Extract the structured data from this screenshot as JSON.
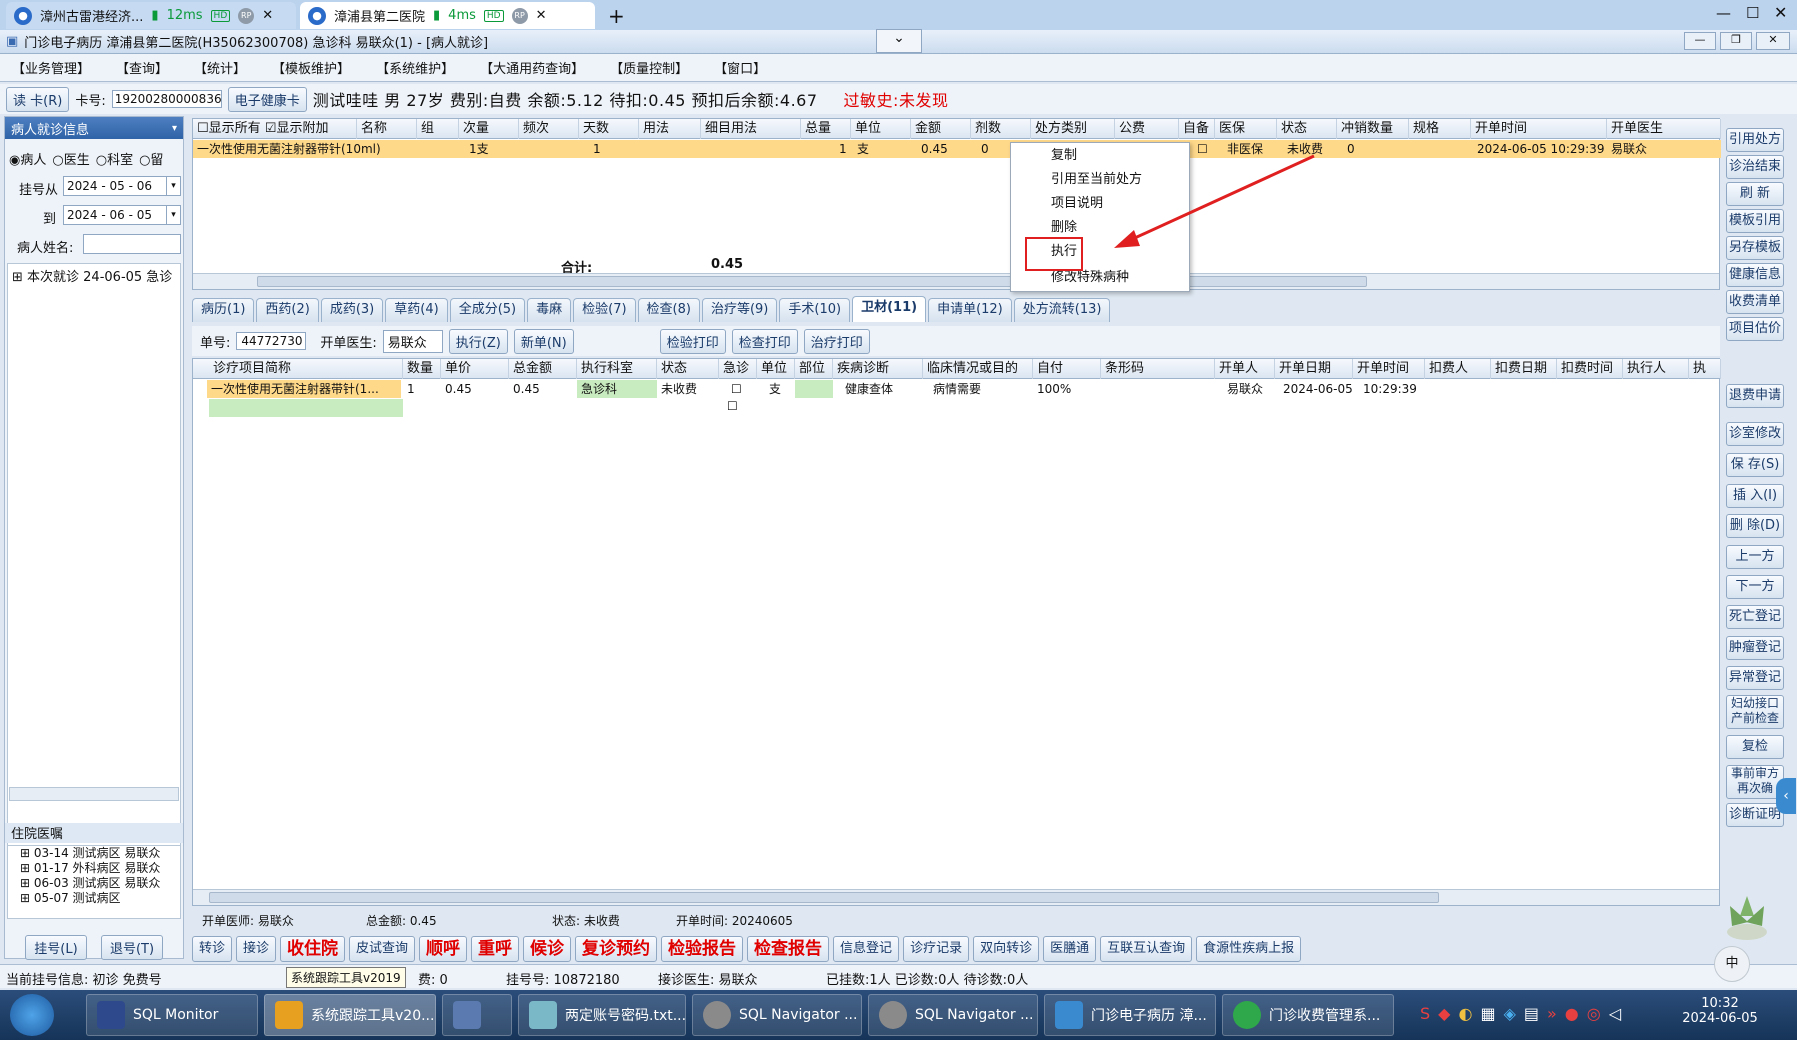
{
  "browser_tabs": [
    {
      "title": "漳州古雷港经济...",
      "ping": "12ms",
      "hd": "HD",
      "rp": "RP"
    },
    {
      "title": "漳浦县第二医院",
      "ping": "4ms",
      "hd": "HD",
      "rp": "RP"
    }
  ],
  "app": {
    "title": "门诊电子病历  漳浦县第二医院(H35062300708)  急诊科  易联众(1) - [病人就诊]",
    "menu": [
      "【业务管理】",
      "【查询】",
      "【统计】",
      "【模板维护】",
      "【系统维护】",
      "【大通用药查询】",
      "【质量控制】",
      "【窗口】"
    ]
  },
  "patient": {
    "read_card": "读 卡(R)",
    "card_label": "卡号:",
    "card_no": "1920028000083667",
    "health_card": "电子健康卡",
    "summary": "测试哇哇 男 27岁 费别:自费 余额:5.12 待扣:0.45 预扣后余额:4.67",
    "allergy": "过敏史:未发现"
  },
  "left": {
    "header": "病人就诊信息",
    "radio": [
      "病人",
      "医生",
      "科室",
      "留"
    ],
    "date_from_label": "挂号从",
    "date_from": "2024 - 05 - 06",
    "date_to_label": "到",
    "date_to": "2024 - 06 - 05",
    "name_label": "病人姓名:",
    "tree_item": "本次就诊 24-06-05 急诊",
    "inpatient_header": "住院医嘱",
    "inpatient_items": [
      "03-14 测试病区 易联众",
      "01-17 外科病区 易联众",
      "06-03 测试病区 易联众",
      "05-07 测试病区"
    ],
    "btn_register": "挂号(L)",
    "btn_unregister": "退号(T)"
  },
  "top_grid": {
    "checks": [
      "显示所有",
      "显示附加"
    ],
    "headers": [
      "名称",
      "组",
      "次量",
      "频次",
      "天数",
      "用法",
      "细目用法",
      "总量",
      "单位",
      "金额",
      "剂数",
      "处方类别",
      "公费",
      "自备",
      "医保",
      "状态",
      "冲销数量",
      "规格",
      "开单时间",
      "开单医生"
    ],
    "row": {
      "name": "一次性使用无菌注射器带针(10ml)",
      "dose": "1支",
      "days": "1",
      "total": "1",
      "unit": "支",
      "amount": "0.45",
      "doses": "0",
      "insurance": "非医保",
      "status": "未收费",
      "writeoff": "0",
      "time": "2024-06-05 10:29:39",
      "doctor": "易联众"
    },
    "sum_label": "合计:",
    "sum_value": "0.45"
  },
  "context_menu": [
    "复制",
    "引用至当前处方",
    "项目说明",
    "删除",
    "执行",
    "修改特殊病种"
  ],
  "tabs": [
    "病历(1)",
    "西药(2)",
    "成药(3)",
    "草药(4)",
    "全成分(5)",
    "毒麻",
    "检验(7)",
    "检查(8)",
    "治疗等(9)",
    "手术(10)",
    "卫材(11)",
    "申请单(12)",
    "处方流转(13)"
  ],
  "order_toolbar": {
    "order_label": "单号:",
    "order_no": "44772730",
    "doctor_label": "开单医生:",
    "doctor": "易联众",
    "btn_exec": "执行(Z)",
    "btn_new": "新单(N)",
    "btn_lab_print": "检验打印",
    "btn_exam_print": "检查打印",
    "btn_treat_print": "治疗打印"
  },
  "order_grid": {
    "headers": [
      "诊疗项目简称",
      "数量",
      "单价",
      "总金额",
      "执行科室",
      "状态",
      "急诊",
      "单位",
      "部位",
      "疾病诊断",
      "临床情况或目的",
      "自付",
      "条形码",
      "开单人",
      "开单日期",
      "开单时间",
      "扣费人",
      "扣费日期",
      "扣费时间",
      "执行人",
      "执"
    ],
    "row": {
      "name": "一次性使用无菌注射器带针(1...",
      "qty": "1",
      "price": "0.45",
      "total": "0.45",
      "dept": "急诊科",
      "status": "未收费",
      "unit": "支",
      "diag": "健康查体",
      "purpose": "病情需要",
      "selfpay": "100%",
      "creator": "易联众",
      "date": "2024-06-05",
      "time": "10:29:39"
    }
  },
  "status_row": {
    "doctor": "开单医师: 易联众",
    "total": "总金额: 0.45",
    "state": "状态: 未收费",
    "time": "开单时间: 20240605"
  },
  "right_buttons": [
    "引用处方",
    "诊治结束",
    "刷 新",
    "模板引用",
    "另存模板",
    "健康信息",
    "收费清单",
    "项目估价",
    "退费申请",
    "诊室修改",
    "保 存(S)",
    "插 入(I)",
    "删 除(D)",
    "上一方",
    "下一方",
    "死亡登记",
    "肿瘤登记",
    "异常登记",
    "妇幼接口产前检查",
    "复检",
    "事前审方再次确",
    "诊断证明"
  ],
  "bottom_buttons": [
    {
      "label": "转诊",
      "red": false
    },
    {
      "label": "接诊",
      "red": false
    },
    {
      "label": "收住院",
      "red": true
    },
    {
      "label": "皮试查询",
      "red": false
    },
    {
      "label": "顺呼",
      "red": true
    },
    {
      "label": "重呼",
      "red": true
    },
    {
      "label": "候诊",
      "red": true
    },
    {
      "label": "复诊预约",
      "red": true
    },
    {
      "label": "检验报告",
      "red": true
    },
    {
      "label": "检查报告",
      "red": true
    },
    {
      "label": "信息登记",
      "red": false
    },
    {
      "label": "诊疗记录",
      "red": false
    },
    {
      "label": "双向转诊",
      "red": false
    },
    {
      "label": "医膳通",
      "red": false
    },
    {
      "label": "互联互认查询",
      "red": false
    },
    {
      "label": "食源性疾病上报",
      "red": false
    }
  ],
  "statusbar": {
    "current_reg": "当前挂号信息:  初诊 免费号",
    "tooltip": "系统跟踪工具v2019",
    "fee": "费: 0",
    "reg_no": "挂号号:  10872180",
    "receiving_doctor": "接诊医生:  易联众",
    "counts": "已挂数:1人  已诊数:0人  待诊数:0人"
  },
  "taskbar": {
    "items": [
      "SQL Monitor",
      "系统跟踪工具v20...",
      "",
      "两定账号密码.txt...",
      "SQL Navigator ...",
      "SQL Navigator ...",
      "门诊电子病历  漳...",
      "门诊收费管理系..."
    ],
    "time": "10:32",
    "date": "2024-06-05",
    "ime": "中"
  },
  "colors": {
    "highlight_row": "#ffd98a",
    "accent": "#2f63a7",
    "red": "#e00000",
    "annotation": "#e02020"
  }
}
